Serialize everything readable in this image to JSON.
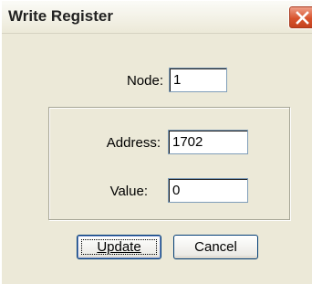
{
  "window": {
    "title": "Write Register"
  },
  "form": {
    "node_label": "Node:",
    "node_value": "1",
    "address_label": "Address:",
    "address_value": "1702",
    "value_label": "Value:",
    "value_value": "0"
  },
  "buttons": {
    "update_label": "Update",
    "cancel_label": "Cancel"
  },
  "icons": {
    "close": "close-icon"
  }
}
